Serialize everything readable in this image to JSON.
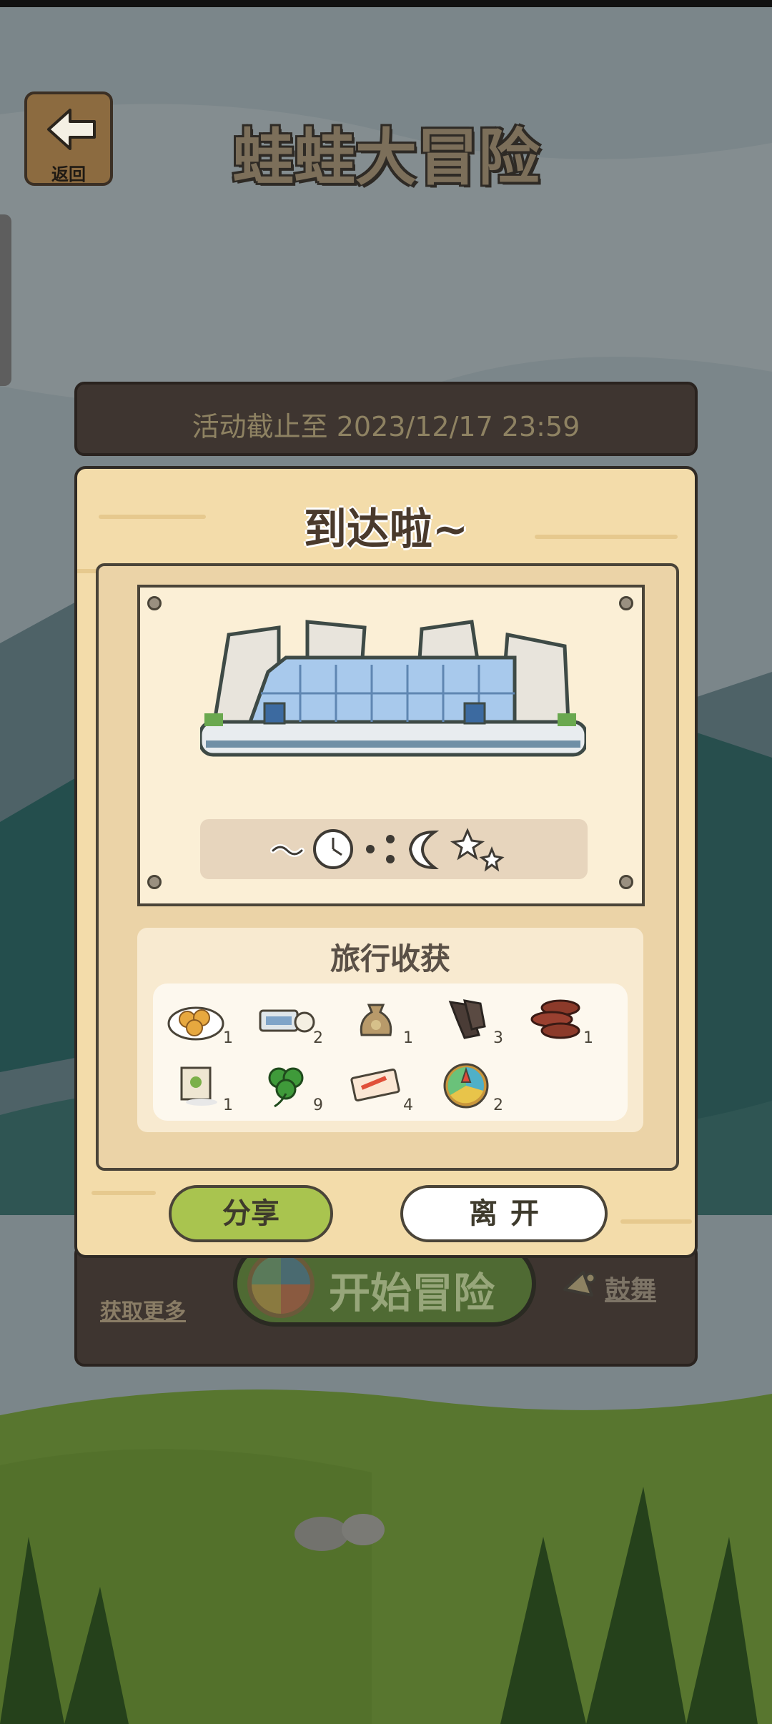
{
  "header": {
    "back_label": "返回",
    "title": "蛙蛙大冒险"
  },
  "board": {
    "deadline": "活动截止至 2023/12/17 23:59",
    "get_more": "获取更多",
    "start_label": "开始冒险",
    "cheer_label": "鼓舞"
  },
  "dialog": {
    "title": "到达啦~",
    "harvest_title": "旅行收获",
    "items": [
      {
        "icon": "cookies-plate-icon",
        "count": "1"
      },
      {
        "icon": "ticket-icon",
        "count": "2"
      },
      {
        "icon": "money-bag-icon",
        "count": "1"
      },
      {
        "icon": "dried-meat-icon",
        "count": "3"
      },
      {
        "icon": "coin-stack-icon",
        "count": "1"
      },
      {
        "icon": "seed-packet-icon",
        "count": "1"
      },
      {
        "icon": "clover-icon",
        "count": "9"
      },
      {
        "icon": "charm-ticket-icon",
        "count": "4"
      },
      {
        "icon": "spinner-wheel-icon",
        "count": "2"
      }
    ],
    "share_label": "分享",
    "leave_label": "离开"
  },
  "colors": {
    "share_button": "#a9c44f",
    "dialog_wood": "#f3dcaa",
    "board_dark": "#3e3530"
  }
}
